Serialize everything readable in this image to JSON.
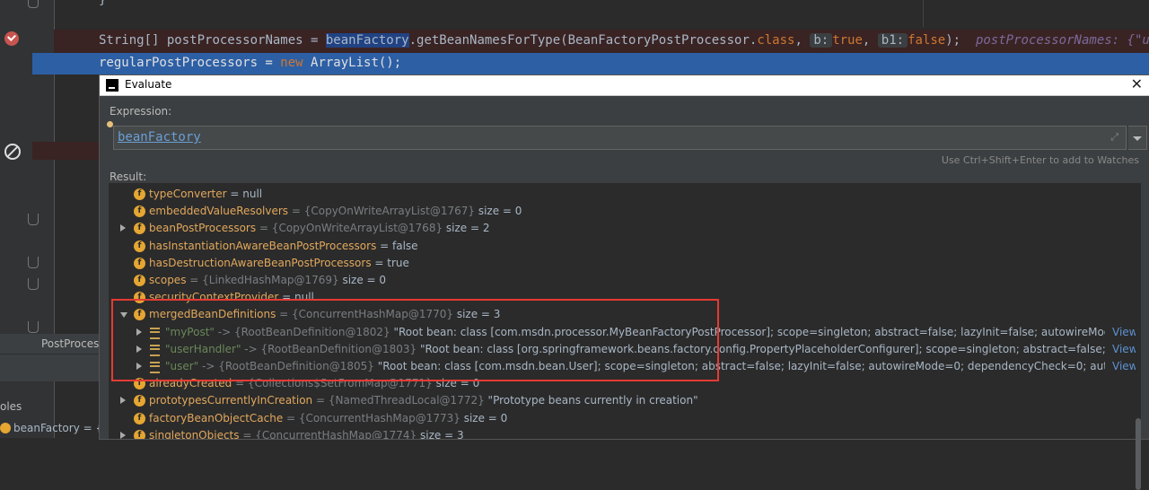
{
  "editor": {
    "top_brace": "}",
    "line1": {
      "type": "String[]",
      "var": " postProcessorNames = ",
      "sel": "beanFactory",
      "call": ".getBeanNamesForType(BeanFactoryPostProcessor.",
      "kw_class": "class",
      "sep": ", ",
      "hint_b": "b:",
      "val_true": "true",
      "sep2": ", ",
      "hint_b1": "b1:",
      "val_false": "false",
      "end": ");",
      "inlay": "postProcessorNames: {\"user"
    },
    "line2": {
      "text": "regularPostProcessors = ",
      "kw_new": "new",
      "rest": " ArrayList();"
    }
  },
  "bottom_left": {
    "tab": "PostProcess",
    "vars_label": "oles",
    "var_item": "beanFactory = {De"
  },
  "dialog": {
    "title": "Evaluate",
    "close": "✕",
    "expression_label": "Expression:",
    "expression_value": "beanFactory",
    "add_watch_hint": "Use Ctrl+Shift+Enter to add to Watches",
    "result_label": "Result:"
  },
  "result_rows": [
    {
      "arrow": "",
      "icon": "f",
      "name": "typeConverter",
      "rest": " = null"
    },
    {
      "arrow": "",
      "icon": "f",
      "name": "embeddedValueResolvers",
      "ref": " = {CopyOnWriteArrayList@1767} ",
      "rest": " size = 0"
    },
    {
      "arrow": "r",
      "icon": "f",
      "name": "beanPostProcessors",
      "ref": " = {CopyOnWriteArrayList@1768} ",
      "rest": " size = 2"
    },
    {
      "arrow": "",
      "icon": "f",
      "name": "hasInstantiationAwareBeanPostProcessors",
      "rest": " = false"
    },
    {
      "arrow": "",
      "icon": "f",
      "name": "hasDestructionAwareBeanPostProcessors",
      "rest": " = true"
    },
    {
      "arrow": "",
      "icon": "f",
      "name": "scopes",
      "ref": " = {LinkedHashMap@1769} ",
      "rest": " size = 0"
    },
    {
      "arrow": "",
      "icon": "f",
      "name": "securityContextProvider",
      "rest": " = null"
    },
    {
      "arrow": "d",
      "icon": "f",
      "name": "mergedBeanDefinitions",
      "ref": " = {ConcurrentHashMap@1770} ",
      "rest": " size = 3"
    },
    {
      "arrow": "r",
      "icon": "m",
      "str": "\"myPost\"",
      "ref": " -> {RootBeanDefinition@1802} ",
      "rest": "\"Root bean: class [com.msdn.processor.MyBeanFactoryPostProcessor]; scope=singleton; abstract=false; lazyInit=false; autowireMode=0; dependencyChec...",
      "view": "View"
    },
    {
      "arrow": "r",
      "icon": "m",
      "str": "\"userHandler\"",
      "ref": " -> {RootBeanDefinition@1803} ",
      "rest": "\"Root bean: class [org.springframework.beans.factory.config.PropertyPlaceholderConfigurer]; scope=singleton; abstract=false; lazyInit=false; autowir...",
      "view": "View"
    },
    {
      "arrow": "r",
      "icon": "m",
      "str": "\"user\"",
      "ref": " -> {RootBeanDefinition@1805} ",
      "rest": "\"Root bean: class [com.msdn.bean.User]; scope=singleton; abstract=false; lazyInit=false; autowireMode=0; dependencyCheck=0; autowireCandidate=true; p...",
      "view": "View"
    },
    {
      "arrow": "",
      "icon": "f",
      "name": "alreadyCreated",
      "ref": " = {Collections$SetFromMap@1771} ",
      "rest": " size = 0"
    },
    {
      "arrow": "r",
      "icon": "f",
      "name": "prototypesCurrentlyInCreation",
      "ref": " = {NamedThreadLocal@1772} ",
      "rest": "\"Prototype beans currently in creation\""
    },
    {
      "arrow": "",
      "icon": "f",
      "name": "factoryBeanObjectCache",
      "ref": " = {ConcurrentHashMap@1773} ",
      "rest": " size = 0"
    },
    {
      "arrow": "r",
      "icon": "f",
      "name": "singletonObjects",
      "ref": " = {ConcurrentHashMap@1774} ",
      "rest": " size = 3"
    }
  ]
}
